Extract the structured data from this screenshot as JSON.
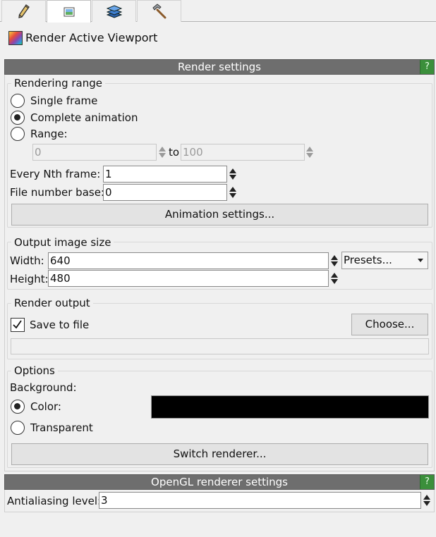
{
  "tabs": [
    {
      "name": "edit",
      "icon": "pencil-icon"
    },
    {
      "name": "render",
      "icon": "render-icon"
    },
    {
      "name": "overlays",
      "icon": "layers-icon"
    },
    {
      "name": "utilities",
      "icon": "hammer-icon"
    }
  ],
  "header": {
    "render_active_label": "Render Active Viewport"
  },
  "render_settings": {
    "title": "Render settings",
    "help": "?",
    "rendering_range": {
      "title": "Rendering range",
      "single_frame": "Single frame",
      "complete_animation": "Complete animation",
      "range": "Range:",
      "range_from": "0",
      "to_label": "to",
      "range_to": "100",
      "selected": "complete_animation"
    },
    "every_nth_label": "Every Nth frame:",
    "every_nth_value": "1",
    "file_number_base_label": "File number base:",
    "file_number_base_value": "0",
    "animation_settings_button": "Animation settings...",
    "output_size": {
      "title": "Output image size",
      "width_label": "Width:",
      "width_value": "640",
      "height_label": "Height:",
      "height_value": "480",
      "presets": "Presets..."
    },
    "render_output": {
      "title": "Render output",
      "save_to_file": "Save to file",
      "save_checked": true,
      "choose_button": "Choose...",
      "filename": ""
    },
    "options": {
      "title": "Options",
      "background_label": "Background:",
      "color_label": "Color:",
      "transparent_label": "Transparent",
      "selected": "color",
      "background_color": "#000000"
    },
    "switch_renderer_button": "Switch renderer..."
  },
  "opengl_settings": {
    "title": "OpenGL renderer settings",
    "help": "?",
    "antialiasing_label": "Antialiasing level:",
    "antialiasing_value": "3"
  }
}
